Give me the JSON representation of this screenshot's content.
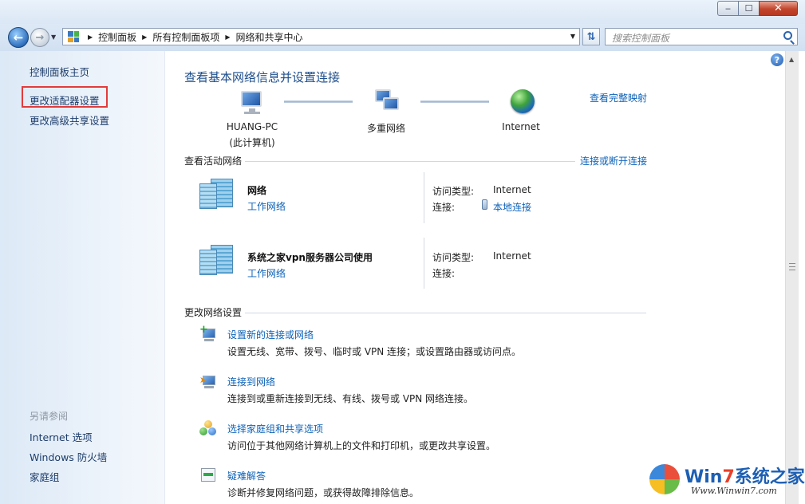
{
  "window": {
    "min_glyph": "‒",
    "max_glyph": "☐",
    "close_glyph": "✕"
  },
  "navbar": {
    "breadcrumb": [
      "控制面板",
      "所有控制面板项",
      "网络和共享中心"
    ],
    "search_placeholder": "搜索控制面板"
  },
  "sidebar": {
    "links": [
      "控制面板主页",
      "更改适配器设置",
      "更改高级共享设置"
    ],
    "see_also_title": "另请参阅",
    "see_also": [
      "Internet 选项",
      "Windows 防火墙",
      "家庭组"
    ]
  },
  "main": {
    "heading": "查看基本网络信息并设置连接",
    "view_full_map": "查看完整映射",
    "map": {
      "computer_name": "HUANG-PC",
      "computer_sub": "(此计算机)",
      "network": "多重网络",
      "internet": "Internet"
    },
    "active_title": "查看活动网络",
    "connect_disconnect": "连接或断开连接",
    "networks": [
      {
        "name": "网络",
        "type": "工作网络",
        "access_label": "访问类型:",
        "access_value": "Internet",
        "conn_label": "连接:",
        "conn_value": "本地连接"
      },
      {
        "name": "系统之家vpn服务器公司使用",
        "type": "工作网络",
        "access_label": "访问类型:",
        "access_value": "Internet",
        "conn_label": "连接:",
        "conn_value": ""
      }
    ],
    "change_title": "更改网络设置",
    "tasks": [
      {
        "title": "设置新的连接或网络",
        "desc": "设置无线、宽带、拨号、临时或 VPN 连接；或设置路由器或访问点。"
      },
      {
        "title": "连接到网络",
        "desc": "连接到或重新连接到无线、有线、拨号或 VPN 网络连接。"
      },
      {
        "title": "选择家庭组和共享选项",
        "desc": "访问位于其他网络计算机上的文件和打印机，或更改共享设置。"
      },
      {
        "title": "疑难解答",
        "desc": "诊断并修复网络问题，或获得故障排除信息。"
      }
    ]
  },
  "watermark": {
    "brand_a": "Win",
    "brand_7": "7",
    "brand_b": "系统之家",
    "url": "Www.Winwin7.com"
  }
}
